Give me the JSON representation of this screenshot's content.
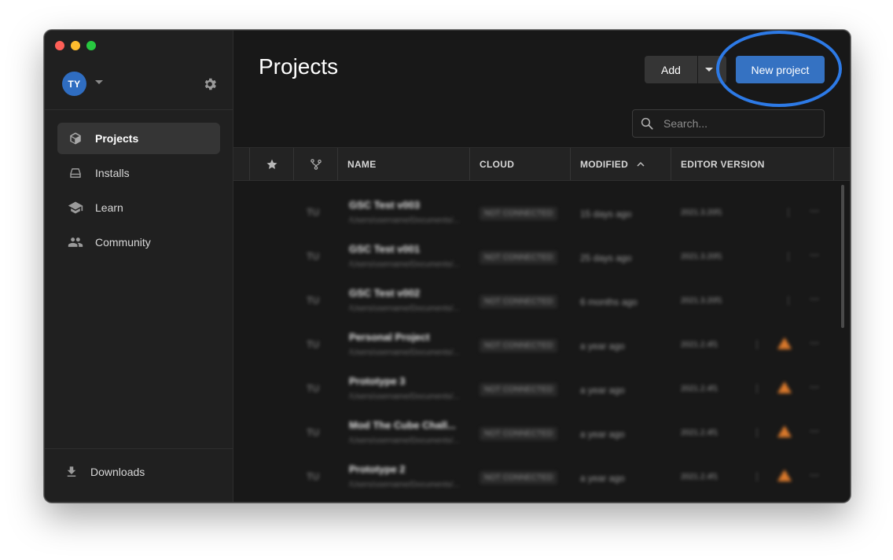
{
  "user": {
    "initials": "TY"
  },
  "sidebar": {
    "items": [
      {
        "label": "Projects",
        "icon": "cube-icon",
        "active": true
      },
      {
        "label": "Installs",
        "icon": "drive-icon",
        "active": false
      },
      {
        "label": "Learn",
        "icon": "graduation-cap-icon",
        "active": false
      },
      {
        "label": "Community",
        "icon": "people-icon",
        "active": false
      }
    ],
    "downloads_label": "Downloads"
  },
  "main": {
    "title": "Projects",
    "add_label": "Add",
    "new_project_label": "New project",
    "search": {
      "placeholder": "Search..."
    },
    "table": {
      "columns": [
        "NAME",
        "CLOUD",
        "MODIFIED",
        "EDITOR VERSION"
      ],
      "sort_column": "MODIFIED",
      "sort_direction": "ascending",
      "rows": [
        {
          "name": "GSC Test v003",
          "path": "/Users/username/Documents/...",
          "cloud": "NOT CONNECTED",
          "modified": "15 days ago",
          "version": "2021.3.20f1",
          "warning": false
        },
        {
          "name": "GSC Test v001",
          "path": "/Users/username/Documents/...",
          "cloud": "NOT CONNECTED",
          "modified": "25 days ago",
          "version": "2021.3.20f1",
          "warning": false
        },
        {
          "name": "GSC Test v002",
          "path": "/Users/username/Documents/...",
          "cloud": "NOT CONNECTED",
          "modified": "6 months ago",
          "version": "2021.3.20f1",
          "warning": false
        },
        {
          "name": "Personal Project",
          "path": "/Users/username/Documents/...",
          "cloud": "NOT CONNECTED",
          "modified": "a year ago",
          "version": "2021.2.4f1",
          "warning": true
        },
        {
          "name": "Prototype 3",
          "path": "/Users/username/Documents/...",
          "cloud": "NOT CONNECTED",
          "modified": "a year ago",
          "version": "2021.2.4f1",
          "warning": true
        },
        {
          "name": "Mod The Cube Chall...",
          "path": "/Users/username/Documents/...",
          "cloud": "NOT CONNECTED",
          "modified": "a year ago",
          "version": "2021.2.4f1",
          "warning": true
        },
        {
          "name": "Prototype 2",
          "path": "/Users/username/Documents/...",
          "cloud": "NOT CONNECTED",
          "modified": "a year ago",
          "version": "2021.2.4f1",
          "warning": true
        }
      ]
    }
  },
  "colors": {
    "accent": "#3572c2",
    "highlight_ring": "#2d7ae6",
    "warning": "#d9782b"
  }
}
